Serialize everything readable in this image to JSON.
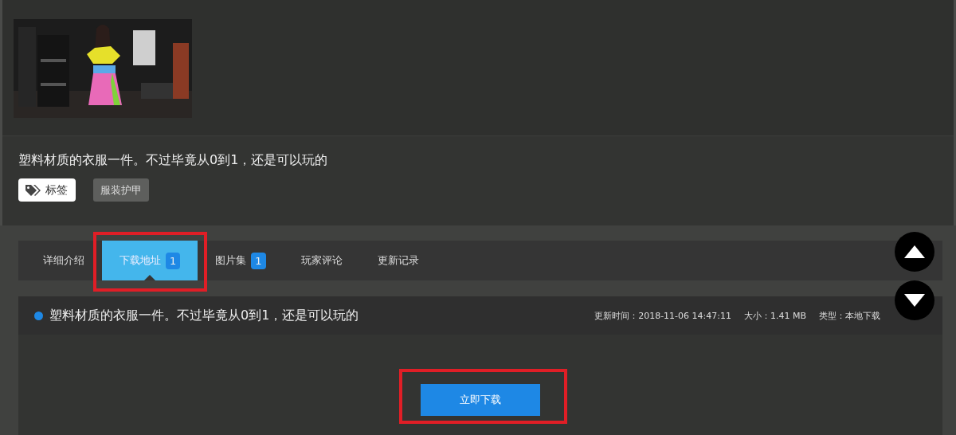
{
  "post": {
    "picture": {
      "kind": "picture"
    },
    "title": "塑料材质的衣服一件。不过毕竟从0到1，还是可以玩的",
    "tag_label": "标签",
    "tags": [
      "服装护甲"
    ]
  },
  "tabs": [
    {
      "label": "详细介绍",
      "selected": false,
      "highlighted": false
    },
    {
      "label": "下载地址",
      "count": "1",
      "selected": true,
      "highlighted": true
    },
    {
      "label": "图片集",
      "count": "1",
      "selected": false,
      "highlighted": false
    },
    {
      "label": "玩家评论",
      "selected": false,
      "highlighted": false
    },
    {
      "label": "更新记录",
      "selected": false,
      "highlighted": false
    }
  ],
  "download": {
    "title": "塑料材质的衣服一件。不过毕竟从0到1，还是可以玩的",
    "meta": [
      "更新时间：2018-11-06 14:47:11",
      "大小：1.41 MB",
      "类型：本地下载"
    ],
    "button": "立即下载",
    "highlighted": true
  },
  "scroll_buttons": [
    {
      "kind": "up"
    },
    {
      "kind": "down"
    }
  ]
}
